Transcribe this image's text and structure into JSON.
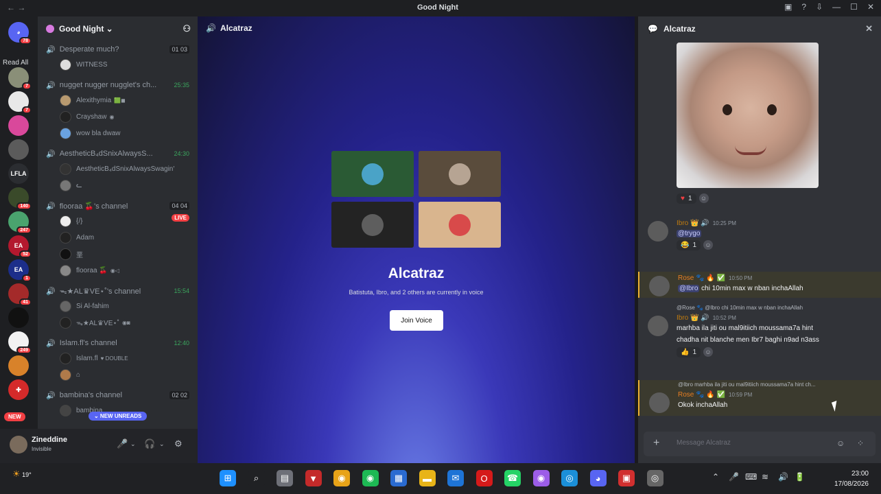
{
  "window": {
    "title": "Good Night",
    "nav_back": "←",
    "nav_forward": "→",
    "controls": [
      "▣",
      "?",
      "⇩",
      "—",
      "☐",
      "✕"
    ]
  },
  "servers": {
    "read_all": "Read All",
    "home_badge": "78",
    "items": [
      {
        "label": "",
        "badge": "7",
        "color": "#8a8f78"
      },
      {
        "label": "",
        "badge": "7",
        "color": "#e8e8e8"
      },
      {
        "label": "",
        "badge": "",
        "color": "#d9489b"
      },
      {
        "label": "",
        "badge": "",
        "color": "#5b5b5b"
      },
      {
        "label": "LFLA",
        "badge": "",
        "color": "#2b2d31"
      },
      {
        "label": "",
        "badge": "140",
        "color": "#3a4a2a"
      },
      {
        "label": "",
        "badge": "247",
        "color": "#4aa36e"
      },
      {
        "label": "EA",
        "badge": "52",
        "color": "#b3182e"
      },
      {
        "label": "EA",
        "badge": "1",
        "color": "#1c2e8a"
      },
      {
        "label": "",
        "badge": "41",
        "color": "#a42a2a"
      },
      {
        "label": "",
        "badge": "",
        "color": "#111111"
      },
      {
        "label": "",
        "badge": "249",
        "color": "#f2f2f2"
      },
      {
        "label": "",
        "badge": "",
        "color": "#d8822a"
      },
      {
        "label": "✚",
        "badge": "",
        "color": "#d42a2a"
      }
    ],
    "new_label": "NEW"
  },
  "guild": {
    "name": "Good Night ⌄",
    "invite_icon": "person-add"
  },
  "channels": [
    {
      "name": "Desperate much?",
      "counter": "01 03",
      "timer": "",
      "live": "",
      "members": [
        {
          "name": "WITNESS",
          "color": "#dddddd",
          "extra": ""
        }
      ]
    },
    {
      "name": "nugget nugger nugglet's ch...",
      "counter": "",
      "timer": "25:35",
      "live": "",
      "members": [
        {
          "name": "Alexithymia",
          "color": "#b89a70",
          "extra": "🟩◼"
        },
        {
          "name": "Crayshaw",
          "color": "#222222",
          "extra": "◉"
        },
        {
          "name": "wow bla dwaw",
          "color": "#6aa2e0",
          "extra": ""
        }
      ]
    },
    {
      "name": "AestheticB₄dSnixAlwaysS...",
      "counter": "",
      "timer": "24:30",
      "live": "",
      "members": [
        {
          "name": "AestheticB₄dSnixAlwaysSwagin'",
          "color": "#333333",
          "extra": ""
        },
        {
          "name": "ᓚ",
          "color": "#777777",
          "extra": ""
        }
      ]
    },
    {
      "name": "flooraa 🍒's channel",
      "counter": "04 04",
      "timer": "",
      "live": "LIVE",
      "members": [
        {
          "name": "{/}",
          "color": "#eeeeee",
          "extra": ""
        },
        {
          "name": "Adam",
          "color": "#222222",
          "extra": ""
        },
        {
          "name": "垩",
          "color": "#111111",
          "extra": ""
        },
        {
          "name": "flooraa 🍒",
          "color": "#888888",
          "extra": "◉◁"
        }
      ]
    },
    {
      "name": "ᯓ★AL♛VE⋆˚'s channel",
      "counter": "",
      "timer": "15:54",
      "live": "",
      "members": [
        {
          "name": "Si Al-fahim",
          "color": "#666666",
          "extra": ""
        },
        {
          "name": "ᯓ★AL♛VE⋆˚",
          "color": "#222222",
          "extra": "◉◙"
        }
      ]
    },
    {
      "name": "Islam.fl's channel",
      "counter": "",
      "timer": "12:40",
      "live": "",
      "members": [
        {
          "name": "Islam.fl",
          "color": "#222222",
          "extra": "♥ DOUBLE"
        },
        {
          "name": "⌂",
          "color": "#b07a4a",
          "extra": ""
        }
      ]
    },
    {
      "name": "bambina's channel",
      "counter": "02 02",
      "timer": "",
      "live": "",
      "members": [
        {
          "name": "bambina",
          "color": "#444444",
          "extra": ""
        }
      ]
    }
  ],
  "new_unreads": "⌄ NEW UNREADS",
  "user": {
    "name": "Zineddine",
    "status": "Invisible"
  },
  "voice": {
    "channel": "Alcatraz",
    "title": "Alcatraz",
    "subtitle": "Batistuta, Ibro, and 2 others are currently in voice",
    "join": "Join Voice",
    "tiles": [
      {
        "bg": "#2a5a34",
        "av": "#4aa3c7"
      },
      {
        "bg": "#5a4c3c",
        "av": "#b6a493"
      },
      {
        "bg": "#232323",
        "av": "#5e5e5e"
      },
      {
        "bg": "#d9b58e",
        "av": "#d84a4a"
      }
    ]
  },
  "chat": {
    "title": "Alcatraz",
    "reactions": [
      {
        "emoji": "♥",
        "count": "1"
      }
    ],
    "messages": [
      {
        "author": "Ibro 👑 🔊",
        "time": "10:25 PM",
        "text": "@trygo",
        "reaction": "😂",
        "count": "1",
        "reply": ""
      },
      {
        "author": "Rose 🐾 🔥 ✅",
        "time": "10:50 PM",
        "text": "@Ibro chi 10min max w nban inchaAllah",
        "reaction": "",
        "count": "",
        "reply": ""
      },
      {
        "author": "Ibro 👑 🔊",
        "time": "10:52 PM",
        "text": "marhba ila jiti ou mal9itiich moussama7a hint",
        "text2": "chadha nit blanche men Ibr7 baghi n9ad n3ass",
        "reaction": "👍",
        "count": "1",
        "reply": "@Rose 🐾 @Ibro chi 10min max w nban inchaAllah"
      },
      {
        "author": "Rose 🐾 🔥 ✅",
        "time": "10:59 PM",
        "text": "Okok inchaAllah",
        "reaction": "",
        "count": "",
        "reply": "@Ibro marhba ila jiti ou mal9itiich moussama7a hint ch..."
      }
    ],
    "placeholder": "Message Alcatraz"
  },
  "taskbar": {
    "weather": "19°",
    "time": "23:00",
    "date": "17/08/2026",
    "apps": [
      {
        "g": "⊞",
        "c": "#1e90ff"
      },
      {
        "g": "⌕",
        "c": "#202124"
      },
      {
        "g": "▤",
        "c": "#6e7078"
      },
      {
        "g": "▼",
        "c": "#c42a2a"
      },
      {
        "g": "◉",
        "c": "#e8a318"
      },
      {
        "g": "◉",
        "c": "#1db954"
      },
      {
        "g": "▦",
        "c": "#2a6bd1"
      },
      {
        "g": "▬",
        "c": "#e8b418"
      },
      {
        "g": "✉",
        "c": "#1e74d6"
      },
      {
        "g": "O",
        "c": "#d51a1a"
      },
      {
        "g": "☎",
        "c": "#25d366"
      },
      {
        "g": "◉",
        "c": "#9c5de8"
      },
      {
        "g": "◎",
        "c": "#1b8fd9"
      },
      {
        "g": "◕",
        "c": "#5865f2"
      },
      {
        "g": "▣",
        "c": "#d12f2f"
      },
      {
        "g": "◎",
        "c": "#666666"
      }
    ],
    "tray": [
      "⌃",
      "🎤",
      "⌨",
      "≋",
      "🔊",
      "🔋"
    ]
  }
}
